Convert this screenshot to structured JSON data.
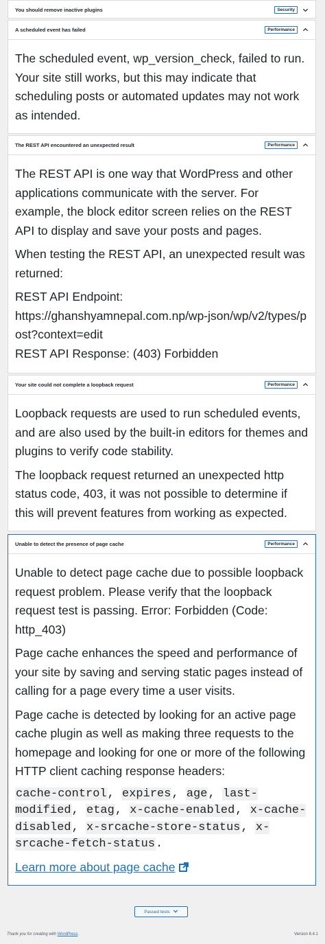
{
  "issues": [
    {
      "title": "You should remove inactive plugins",
      "badge": "Security",
      "expanded": false
    },
    {
      "title": "A scheduled event has failed",
      "badge": "Performance",
      "expanded": true,
      "paragraphs": [
        "The scheduled event, wp_version_check, failed to run. Your site still works, but this may indicate that scheduling posts or automated updates may not work as intended."
      ]
    },
    {
      "title": "The REST API encountered an unexpected result",
      "badge": "Performance",
      "expanded": true,
      "paragraphs": [
        "The REST API is one way that WordPress and other applications communicate with the server. For example, the block editor screen relies on the REST API to display and save your posts and pages.",
        "When testing the REST API, an unexpected result was returned:"
      ],
      "endpoint_label": "REST API Endpoint:",
      "endpoint_url": "https://ghanshyamnepal.com.np/wp-json/wp/v2/types/post?context=edit",
      "response": "REST API Response: (403) Forbidden"
    },
    {
      "title": "Your site could not complete a loopback request",
      "badge": "Performance",
      "expanded": true,
      "paragraphs": [
        "Loopback requests are used to run scheduled events, and are also used by the built-in editors for themes and plugins to verify code stability.",
        "The loopback request returned an unexpected http status code, 403, it was not possible to determine if this will prevent features from working as expected."
      ]
    },
    {
      "title": "Unable to detect the presence of page cache",
      "badge": "Performance",
      "expanded": true,
      "paragraphs": [
        "Unable to detect page cache due to possible loopback request problem. Please verify that the loopback request test is passing. Error: Forbidden (Code: http_403)",
        "Page cache enhances the speed and performance of your site by saving and serving static pages instead of calling for a page every time a user visits.",
        "Page cache is detected by looking for an active page cache plugin as well as making three requests to the homepage and looking for one or more of the following HTTP client caching response headers:"
      ],
      "headers": [
        "cache-control",
        "expires",
        "age",
        "last-modified",
        "etag",
        "x-cache-enabled",
        "x-cache-disabled",
        "x-srcache-store-status",
        "x-srcache-fetch-status"
      ],
      "learn_more": "Learn more about page cache"
    }
  ],
  "passed_tests_label": "Passed tests",
  "footer": {
    "thanks_prefix": "Thank you for creating with ",
    "wordpress_link": "WordPress",
    "thanks_suffix": ".",
    "version": "Version 6.4.1"
  }
}
